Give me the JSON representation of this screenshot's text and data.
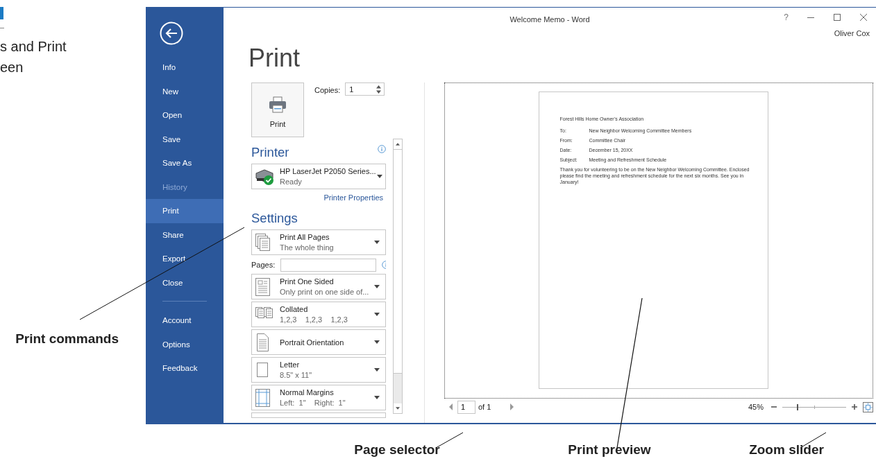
{
  "figure_caption": {
    "lines": [
      "s and Print",
      "een"
    ]
  },
  "window": {
    "title": "Welcome Memo - Word",
    "help": "?",
    "user": "Oliver Cox"
  },
  "nav_main": [
    {
      "label": "Info",
      "selected": false,
      "disabled": false
    },
    {
      "label": "New",
      "selected": false,
      "disabled": false
    },
    {
      "label": "Open",
      "selected": false,
      "disabled": false
    },
    {
      "label": "Save",
      "selected": false,
      "disabled": false
    },
    {
      "label": "Save As",
      "selected": false,
      "disabled": false
    },
    {
      "label": "History",
      "selected": false,
      "disabled": true
    },
    {
      "label": "Print",
      "selected": true,
      "disabled": false
    },
    {
      "label": "Share",
      "selected": false,
      "disabled": false
    },
    {
      "label": "Export",
      "selected": false,
      "disabled": false
    },
    {
      "label": "Close",
      "selected": false,
      "disabled": false
    }
  ],
  "nav_account": [
    {
      "label": "Account",
      "selected": false,
      "disabled": false
    },
    {
      "label": "Options",
      "selected": false,
      "disabled": false
    },
    {
      "label": "Feedback",
      "selected": false,
      "disabled": false
    }
  ],
  "print": {
    "heading": "Print",
    "print_button": "Print",
    "copies": {
      "label": "Copies:",
      "value": "1"
    },
    "printer_heading": "Printer",
    "printer": {
      "name": "HP LaserJet P2050 Series...",
      "status": "Ready"
    },
    "printer_properties": "Printer Properties",
    "settings_heading": "Settings",
    "settings": [
      {
        "kind": "pages",
        "title": "Print All Pages",
        "subtitle": "The whole thing"
      },
      {
        "kind": "field",
        "label": "Pages:"
      },
      {
        "kind": "sides",
        "title": "Print One Sided",
        "subtitle": "Only print on one side of..."
      },
      {
        "kind": "collation",
        "title": "Collated",
        "subtitle": "1,2,3    1,2,3    1,2,3"
      },
      {
        "kind": "orientation",
        "title": "Portrait Orientation"
      },
      {
        "kind": "paper",
        "title": "Letter",
        "subtitle": "8.5\" x 11\""
      },
      {
        "kind": "margins",
        "title": "Normal Margins",
        "subtitle": "Left:  1\"    Right:  1\""
      }
    ]
  },
  "preview": {
    "memo": {
      "heading": "Forest Hills Home Owner’s Association",
      "fields": [
        {
          "label": "To:",
          "value": "New Neighbor Welcoming Committee Members"
        },
        {
          "label": "From:",
          "value": "Committee Chair"
        },
        {
          "label": "Date:",
          "value": "December 15, 20XX"
        },
        {
          "label": "Subject:",
          "value": "Meeting and Refreshment Schedule"
        }
      ],
      "body": "Thank you for volunteering to be on the New Neighbor Welcoming Committee. Enclosed please find the meeting and refreshment schedule for the next six months. See you in January!"
    },
    "page_nav": {
      "page": "1",
      "of": "of 1"
    },
    "zoom": {
      "reading": "45%",
      "level": 0.24
    }
  },
  "side_callout": "Print commands",
  "bottom_callouts": [
    "Page selector",
    "Print preview",
    "Zoom slider"
  ]
}
